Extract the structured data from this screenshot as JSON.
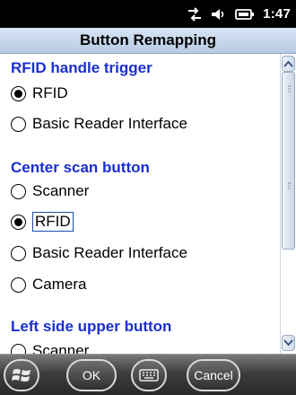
{
  "status_bar": {
    "time": "1:47",
    "icons": [
      "data-connection-icon",
      "volume-icon",
      "battery-icon"
    ]
  },
  "header": {
    "title": "Button Remapping"
  },
  "sections": [
    {
      "heading": "RFID handle trigger",
      "options": [
        {
          "label": "RFID",
          "selected": true
        },
        {
          "label": "Basic Reader Interface",
          "selected": false
        }
      ]
    },
    {
      "heading": "Center scan button",
      "options": [
        {
          "label": "Scanner",
          "selected": false
        },
        {
          "label": "RFID",
          "selected": true,
          "focused": true
        },
        {
          "label": "Basic Reader Interface",
          "selected": false
        },
        {
          "label": "Camera",
          "selected": false
        }
      ]
    },
    {
      "heading": "Left side upper button",
      "options": [
        {
          "label": "Scanner",
          "selected": false
        }
      ]
    }
  ],
  "softkeys": {
    "start_icon": "windows-start-icon",
    "ok_label": "OK",
    "keyboard_icon": "keyboard-icon",
    "cancel_label": "Cancel"
  },
  "colors": {
    "section_heading": "#1a2fd0",
    "title_bar": "#c6d6ec",
    "status_bar": "#000000"
  }
}
